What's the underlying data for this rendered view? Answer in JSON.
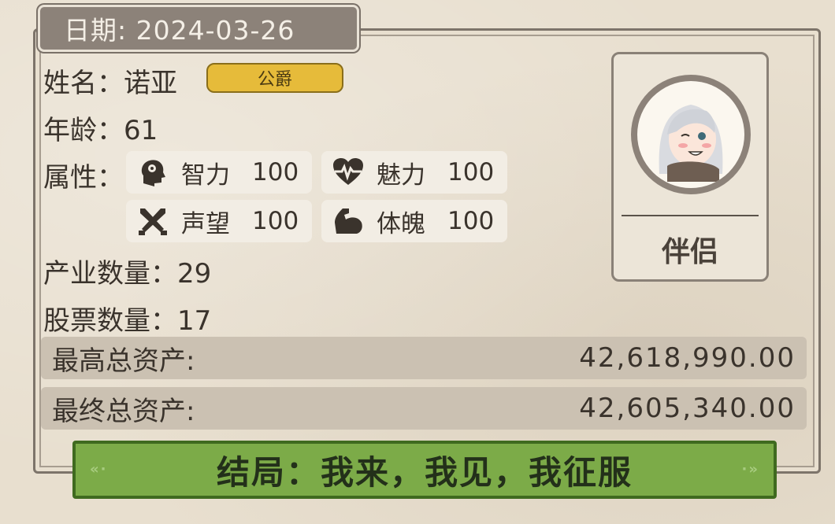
{
  "date": {
    "label": "日期: 2024-03-26"
  },
  "profile": {
    "name_label": "姓名：",
    "name": "诺亚",
    "title_badge": "公爵",
    "age_label": "年龄：",
    "age": "61",
    "attr_label": "属性："
  },
  "attributes": [
    {
      "name": "智力",
      "value": "100",
      "icon": "brain-head-icon"
    },
    {
      "name": "魅力",
      "value": "100",
      "icon": "heartbeat-icon"
    },
    {
      "name": "声望",
      "value": "100",
      "icon": "crossed-swords-icon"
    },
    {
      "name": "体魄",
      "value": "100",
      "icon": "flexed-arm-icon"
    }
  ],
  "stats": {
    "industry_label": "产业数量：",
    "industry": "29",
    "stock_label": "股票数量：",
    "stock": "17"
  },
  "assets": {
    "max_label": "最高总资产:",
    "max_value": "42,618,990.00",
    "final_label": "最终总资产:",
    "final_value": "42,605,340.00"
  },
  "partner": {
    "label": "伴侣"
  },
  "ending": {
    "text": "结局：我来，我见，我征服"
  },
  "colors": {
    "panel_bg": "#e8dfcf",
    "date_tab": "#8c8279",
    "badge_gold": "#e6bb3a",
    "banner_green": "#7cab48",
    "asset_row": "#cbc1b2"
  }
}
